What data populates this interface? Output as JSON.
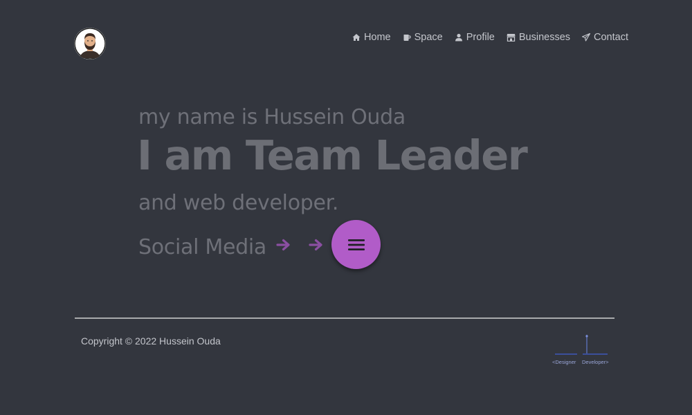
{
  "nav": {
    "items": [
      {
        "label": "Home",
        "icon": "home-icon"
      },
      {
        "label": "Space",
        "icon": "mug-icon"
      },
      {
        "label": "Profile",
        "icon": "user-icon"
      },
      {
        "label": "Businesses",
        "icon": "store-icon"
      },
      {
        "label": "Contact",
        "icon": "paper-plane-icon"
      }
    ]
  },
  "hero": {
    "intro": "my name is Hussein Ouda",
    "title": "I am Team Leader",
    "subtitle": "and web developer.",
    "social_label": "Social Media"
  },
  "footer": {
    "copyright": "Copyright © 2022 Hussein Ouda",
    "logo_left": "<Designer",
    "logo_right": "Developer>"
  },
  "colors": {
    "background": "#33363e",
    "accent": "#b15cc8",
    "arrow": "#8b4fa2",
    "nav_text": "#c4c6cc",
    "hero_text": "#6e7078"
  }
}
